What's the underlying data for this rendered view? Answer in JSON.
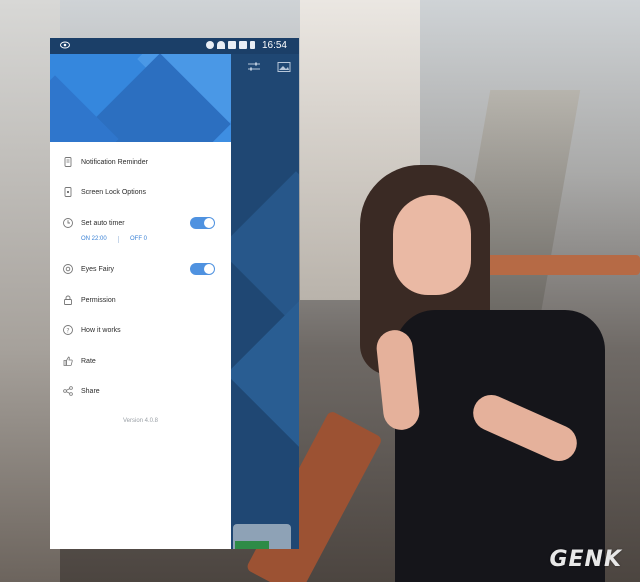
{
  "status_bar": {
    "time": "16:54"
  },
  "drawer": {
    "items": [
      {
        "label": "Notification Reminder",
        "icon": "notification-icon"
      },
      {
        "label": "Screen Lock Options",
        "icon": "screen-lock-icon"
      },
      {
        "label": "Set auto timer",
        "icon": "timer-icon",
        "toggle": true,
        "on": true
      },
      {
        "label": "Eyes Fairy",
        "icon": "eye-icon",
        "toggle": true,
        "on": true
      },
      {
        "label": "Permission",
        "icon": "lock-icon"
      },
      {
        "label": "How it works",
        "icon": "help-icon"
      },
      {
        "label": "Rate",
        "icon": "thumbs-up-icon"
      },
      {
        "label": "Share",
        "icon": "share-icon"
      }
    ],
    "timer": {
      "on_label": "ON 22:00",
      "off_label": "OFF 0"
    },
    "version": "Version 4.0.8"
  },
  "watermark": "GENK",
  "colors": {
    "accent": "#3e8ee2",
    "toggle": "#4f92e0",
    "app_bg": "#1f4773"
  }
}
